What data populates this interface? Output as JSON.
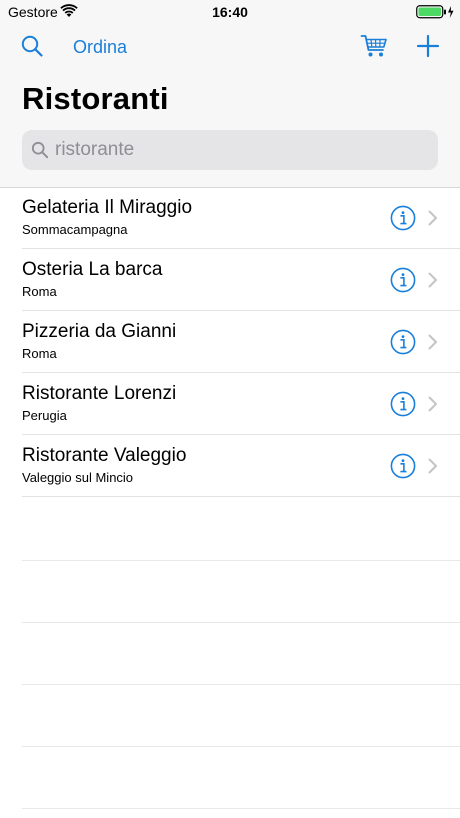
{
  "status_bar": {
    "carrier": "Gestore",
    "time": "16:40"
  },
  "nav": {
    "left_button_label": "Ordina",
    "left_icon": "search-icon",
    "right_icons": [
      "cart-icon",
      "plus-icon"
    ],
    "accent_color": "#1a7fd9"
  },
  "page": {
    "title": "Ristoranti"
  },
  "search": {
    "value": "ristorante",
    "icon": "magnifier-icon"
  },
  "restaurants": [
    {
      "name": "Gelateria Il Miraggio",
      "city": "Sommacampagna"
    },
    {
      "name": "Osteria La barca",
      "city": "Roma"
    },
    {
      "name": "Pizzeria da Gianni",
      "city": "Roma"
    },
    {
      "name": "Ristorante Lorenzi",
      "city": "Perugia"
    },
    {
      "name": "Ristorante Valeggio",
      "city": "Valeggio sul Mincio"
    }
  ],
  "row_icons": {
    "info": "info-icon",
    "chevron": "chevron-right-icon"
  }
}
